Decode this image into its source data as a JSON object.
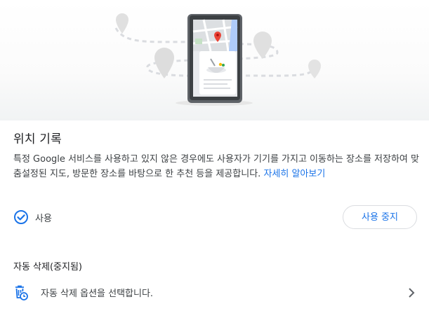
{
  "colors": {
    "accent": "#1a73e8",
    "text_primary": "#202124",
    "text_secondary": "#3c4043",
    "divider": "#dadce0",
    "map_pin": "#ea4335"
  },
  "hero": {
    "illustration_icon": "phone-map-illustration"
  },
  "page_title": "위치 기록",
  "description": {
    "text": "특정 Google 서비스를 사용하고 있지 않은 경우에도 사용자가 기기를 가지고 이동하는 장소를 저장하여 맞춤설정된 지도, 방문한 장소를 바탕으로 한 추천 등을 제공합니다.",
    "link_label": "자세히 알아보기"
  },
  "status": {
    "icon": "check-circle-icon",
    "label": "사용"
  },
  "pause_button_label": "사용 중지",
  "auto_delete": {
    "section_title": "자동 삭제(중지됨)",
    "icon": "auto-delete-icon",
    "option_label": "자동 삭제 옵션을 선택합니다.",
    "chevron_icon": "chevron-right-icon"
  }
}
